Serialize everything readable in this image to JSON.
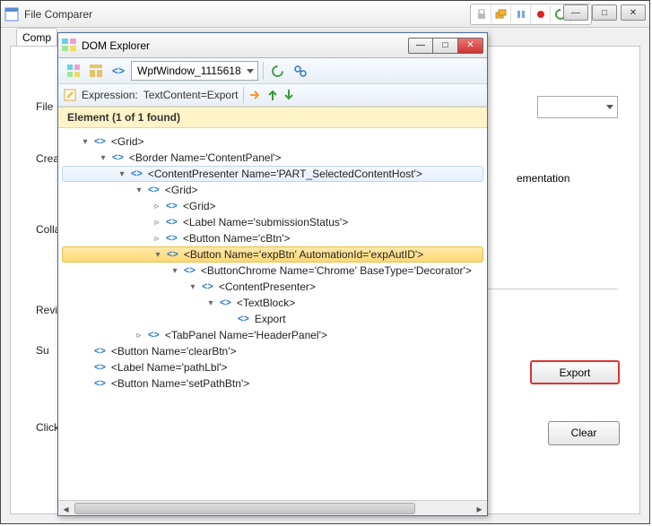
{
  "main": {
    "title": "File Comparer",
    "win_buttons": {
      "min": "—",
      "max": "□",
      "close": "✕"
    },
    "tab_label": "Comp",
    "labels": {
      "file": "File",
      "crea": "Crea",
      "colla": "Colla",
      "revi": "Revi",
      "sub": "Su",
      "click_s": "Click S"
    },
    "side_text": "ementation",
    "export_btn": "Export",
    "clear_btn": "Clear"
  },
  "dom": {
    "title": "DOM Explorer",
    "combo_value": "WpfWindow_1115618",
    "expr_label": "Expression:",
    "expr_value": "TextContent=Export",
    "result_bar": "Element (1 of 1 found)",
    "tree": [
      {
        "depth": 1,
        "arrow": "▾",
        "text": "<Grid>"
      },
      {
        "depth": 2,
        "arrow": "▾",
        "text": "<Border Name='ContentPanel'>"
      },
      {
        "depth": 3,
        "arrow": "▾",
        "text": "<ContentPresenter Name='PART_SelectedContentHost'>",
        "state": "hover"
      },
      {
        "depth": 4,
        "arrow": "▾",
        "text": "<Grid>"
      },
      {
        "depth": 5,
        "arrow": "▹",
        "text": "<Grid>"
      },
      {
        "depth": 5,
        "arrow": "▹",
        "text": "<Label Name='submissionStatus'>"
      },
      {
        "depth": 5,
        "arrow": "▹",
        "text": "<Button Name='cBtn'>"
      },
      {
        "depth": 5,
        "arrow": "▾",
        "text": "<Button Name='expBtn' AutomationId='expAutID'>",
        "state": "selected"
      },
      {
        "depth": 6,
        "arrow": "▾",
        "text": "<ButtonChrome Name='Chrome' BaseType='Decorator'>"
      },
      {
        "depth": 7,
        "arrow": "▾",
        "text": "<ContentPresenter>"
      },
      {
        "depth": 8,
        "arrow": "▾",
        "text": "<TextBlock>"
      },
      {
        "depth": 9,
        "arrow": "",
        "text": "Export"
      },
      {
        "depth": 4,
        "arrow": "▹",
        "text": "<TabPanel Name='HeaderPanel'>"
      },
      {
        "depth": 1,
        "arrow": "",
        "text": "<Button Name='clearBtn'>"
      },
      {
        "depth": 1,
        "arrow": "",
        "text": "<Label Name='pathLbl'>"
      },
      {
        "depth": 1,
        "arrow": "",
        "text": "<Button Name='setPathBtn'>"
      }
    ]
  },
  "colors": {
    "accent": "#2a7ad1",
    "highlight_bg": "#ffe9a8"
  }
}
